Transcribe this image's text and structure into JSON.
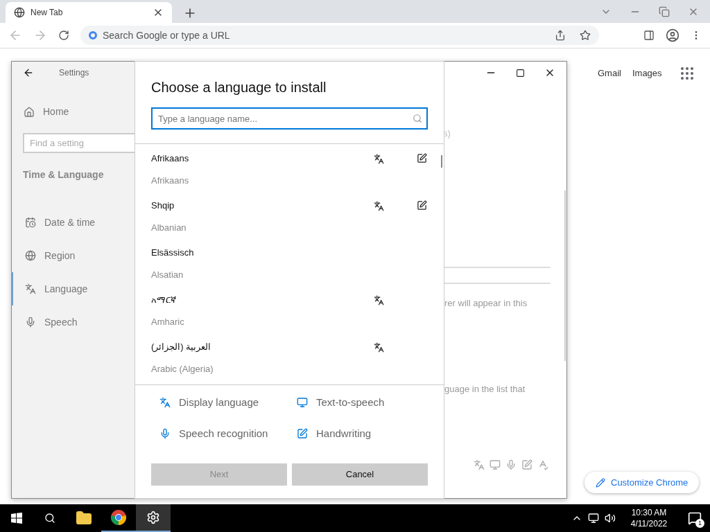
{
  "browser": {
    "tab": {
      "title": "New Tab"
    },
    "address_bar": {
      "placeholder": "Search Google or type a URL"
    },
    "links": [
      "Gmail",
      "Images"
    ],
    "customize_button": "Customize Chrome"
  },
  "settings": {
    "title": "Settings",
    "home": "Home",
    "search": {
      "placeholder": "Find a setting"
    },
    "section": "Time & Language",
    "items": [
      {
        "label": "Date & time",
        "kind": "date",
        "selected": false
      },
      {
        "label": "Region",
        "kind": "region",
        "selected": false
      },
      {
        "label": "Language",
        "kind": "language",
        "selected": true
      },
      {
        "label": "Speech",
        "kind": "speech",
        "selected": false
      }
    ],
    "background_texts": [
      "s)",
      "rer will appear in this",
      "guage in the list that"
    ]
  },
  "dialog": {
    "title": "Choose a language to install",
    "search": {
      "placeholder": "Type a language name..."
    },
    "languages": [
      {
        "native": "Afrikaans",
        "english": "Afrikaans",
        "display": true,
        "handwriting": true
      },
      {
        "native": "Shqip",
        "english": "Albanian",
        "display": true,
        "handwriting": true
      },
      {
        "native": "Elsässisch",
        "english": "Alsatian",
        "display": false,
        "handwriting": false
      },
      {
        "native": "አማርኛ",
        "english": "Amharic",
        "display": true,
        "handwriting": false
      },
      {
        "native": "العربية (الجزائر)",
        "english": "Arabic (Algeria)",
        "display": true,
        "handwriting": false
      }
    ],
    "legend": [
      {
        "kind": "display",
        "label": "Display language"
      },
      {
        "kind": "tts",
        "label": "Text-to-speech"
      },
      {
        "kind": "speech",
        "label": "Speech recognition"
      },
      {
        "kind": "handwriting",
        "label": "Handwriting"
      }
    ],
    "buttons": [
      {
        "label": "Next",
        "disabled": true
      },
      {
        "label": "Cancel",
        "disabled": false
      }
    ]
  },
  "taskbar": {
    "time": "10:30 AM",
    "date": "4/11/2022",
    "notifications": "1"
  }
}
